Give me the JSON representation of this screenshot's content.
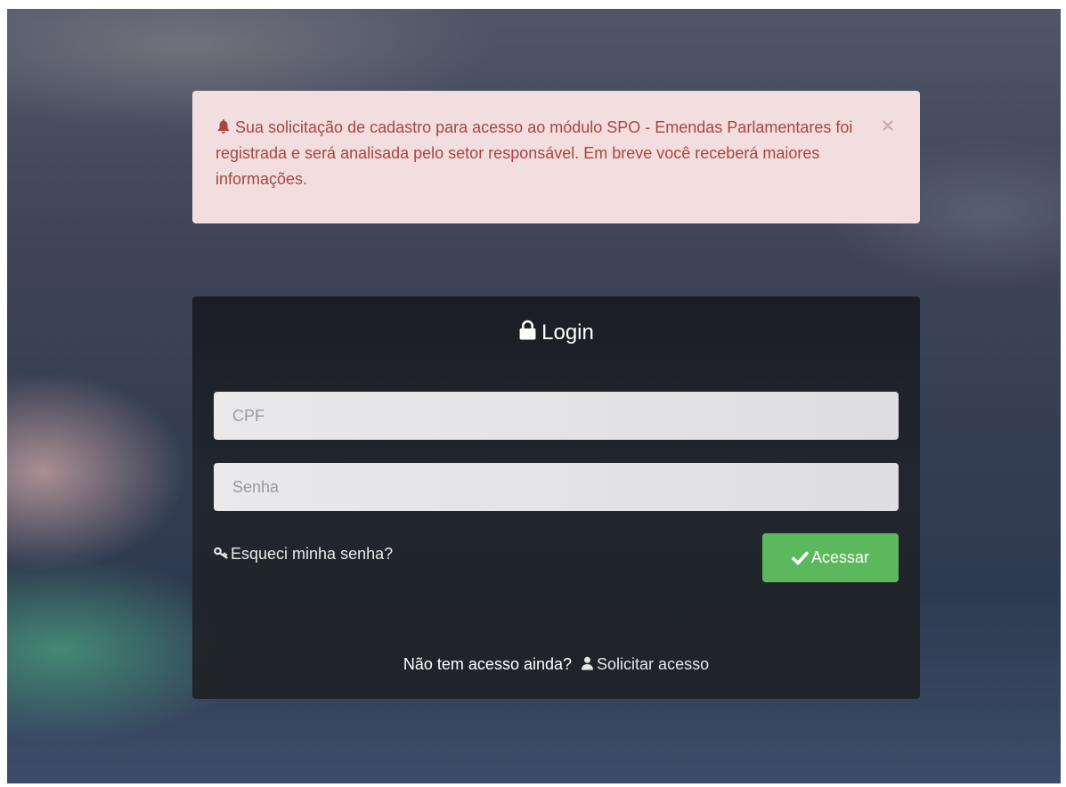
{
  "alert": {
    "message": "Sua solicitação de cadastro para acesso ao módulo SPO - Emendas Parlamentares foi registrada e será analisada pelo setor responsável. Em breve você receberá maiores informações.",
    "icon": "bell-icon",
    "close_icon": "close-icon",
    "color": "#a94442",
    "background": "#f2dede"
  },
  "login": {
    "title": "Login",
    "title_icon": "lock-icon",
    "cpf_placeholder": "CPF",
    "cpf_value": "",
    "password_placeholder": "Senha",
    "password_value": "",
    "forgot_label": "Esqueci minha senha?",
    "forgot_icon": "key-icon",
    "submit_label": "Acessar",
    "submit_icon": "check-icon",
    "submit_color": "#5cb85c"
  },
  "footer": {
    "question": "Não tem acesso ainda?",
    "request_label": "Solicitar acesso",
    "request_icon": "user-icon"
  }
}
